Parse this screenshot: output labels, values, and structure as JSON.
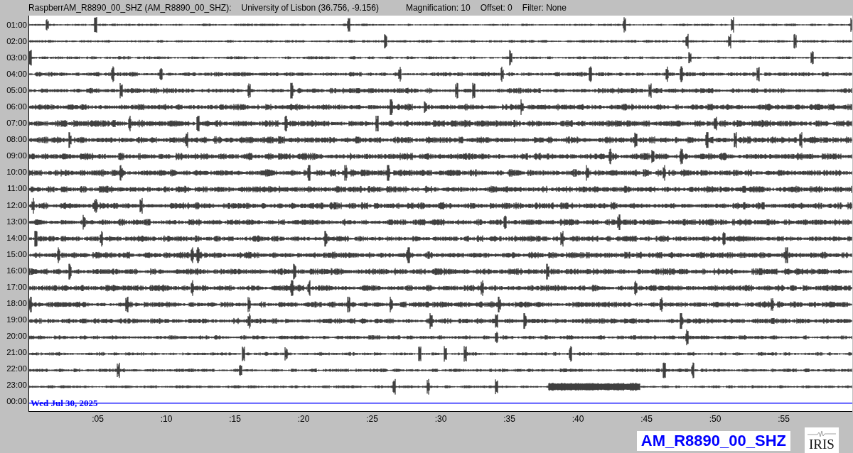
{
  "header": {
    "station": "RaspberrAM_R8890_00_SHZ (AM_R8890_00_SHZ):",
    "location": "University of Lisbon (36.756, -9.156)",
    "magnification": "Magnification: 10",
    "offset": "Offset: 0",
    "filter": "Filter: None"
  },
  "helicorder": {
    "rows": [
      {
        "label": "01:00",
        "kind": "trace"
      },
      {
        "label": "02:00",
        "kind": "trace"
      },
      {
        "label": "03:00",
        "kind": "trace"
      },
      {
        "label": "04:00",
        "kind": "trace"
      },
      {
        "label": "05:00",
        "kind": "trace"
      },
      {
        "label": "06:00",
        "kind": "trace"
      },
      {
        "label": "07:00",
        "kind": "trace"
      },
      {
        "label": "08:00",
        "kind": "trace"
      },
      {
        "label": "09:00",
        "kind": "trace"
      },
      {
        "label": "10:00",
        "kind": "trace"
      },
      {
        "label": "11:00",
        "kind": "trace"
      },
      {
        "label": "12:00",
        "kind": "trace"
      },
      {
        "label": "13:00",
        "kind": "trace"
      },
      {
        "label": "14:00",
        "kind": "trace"
      },
      {
        "label": "15:00",
        "kind": "trace"
      },
      {
        "label": "16:00",
        "kind": "trace"
      },
      {
        "label": "17:00",
        "kind": "trace"
      },
      {
        "label": "18:00",
        "kind": "trace"
      },
      {
        "label": "19:00",
        "kind": "trace"
      },
      {
        "label": "20:00",
        "kind": "trace"
      },
      {
        "label": "21:00",
        "kind": "trace"
      },
      {
        "label": "22:00",
        "kind": "trace"
      },
      {
        "label": "23:00",
        "kind": "trace"
      },
      {
        "label": "00:00",
        "kind": "current"
      }
    ],
    "date": "Wed Jul 30, 2025",
    "xticks": [
      ":05",
      ":10",
      ":15",
      ":20",
      ":25",
      ":30",
      ":35",
      ":40",
      ":45",
      ":50",
      ":55"
    ]
  },
  "channel_badge": "AM_R8890_00_SHZ",
  "logo": {
    "text": "IRIS"
  }
}
